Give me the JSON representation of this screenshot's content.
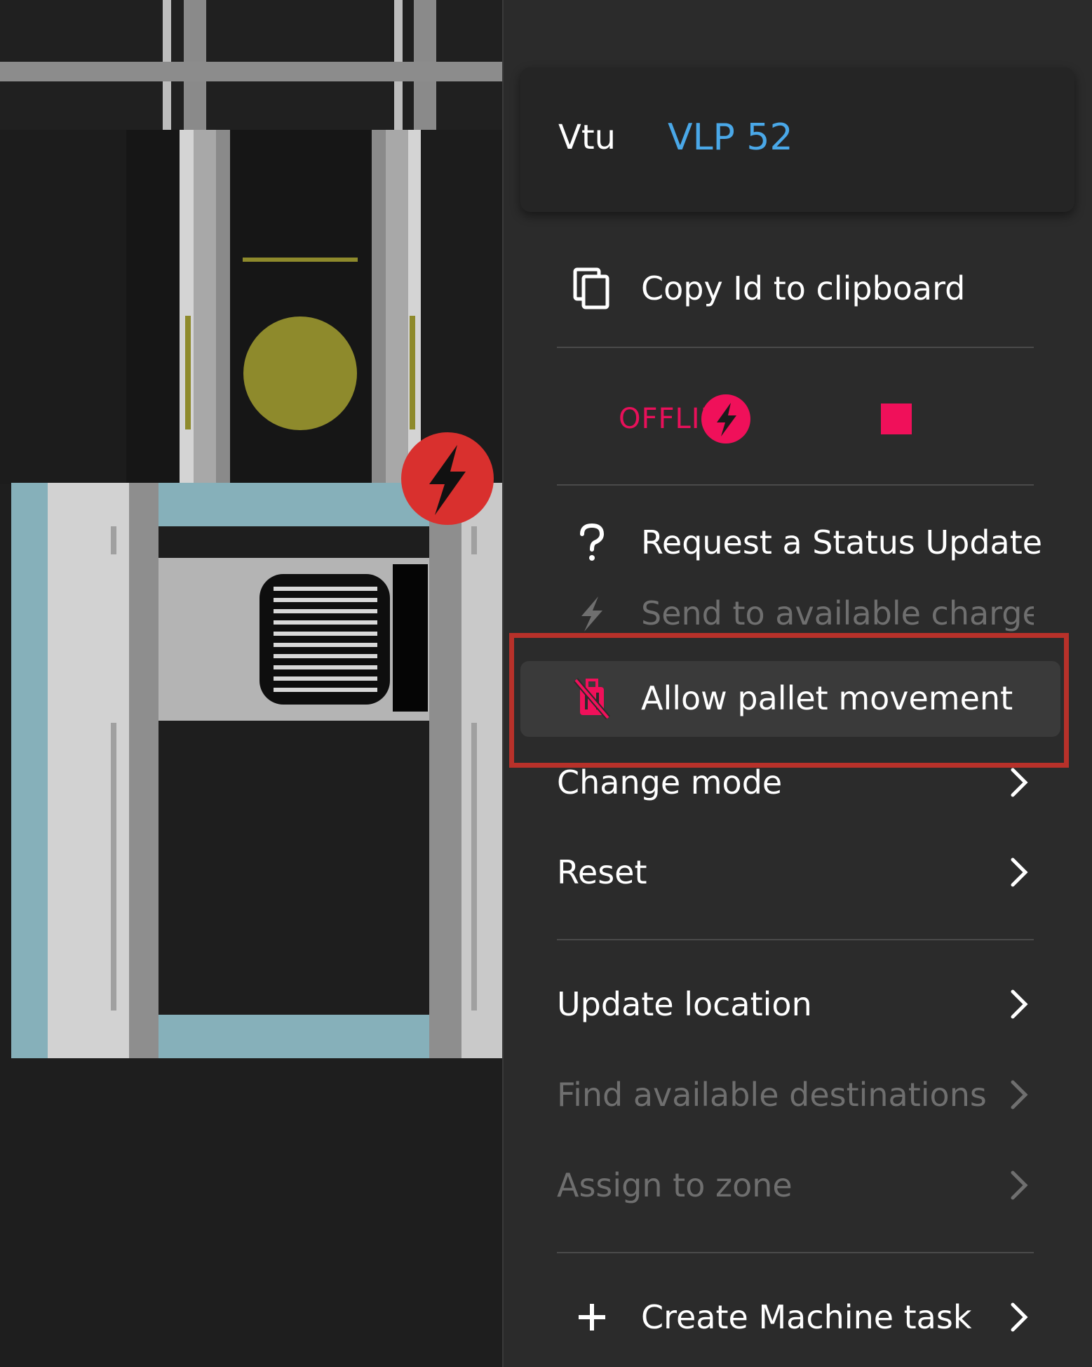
{
  "header": {
    "type_label": "Vtu",
    "id_label": "VLP 52"
  },
  "status": {
    "text": "OFFLINE",
    "color": "#e8105a"
  },
  "menu": {
    "copy_id": "Copy Id to clipboard",
    "request_status": "Request a Status Update",
    "send_to_charger": "Send to available charger",
    "allow_pallet": "Allow pallet movement",
    "change_mode": "Change mode",
    "reset": "Reset",
    "update_location": "Update location",
    "find_destinations": "Find available destinations",
    "assign_zone": "Assign to zone",
    "create_task": "Create Machine task"
  },
  "icons": {
    "copy": "copy-icon",
    "question": "question-icon",
    "lightning": "lightning-icon",
    "no_luggage": "no-luggage-icon",
    "plus": "plus-icon",
    "chevron": "chevron-right-icon"
  },
  "colors": {
    "accent_blue": "#4aa8e8",
    "alert_pink": "#f0105a",
    "highlight_red": "#b8312a",
    "vehicle_blue": "#86b0ba",
    "status_olive": "#8e8a2c"
  }
}
